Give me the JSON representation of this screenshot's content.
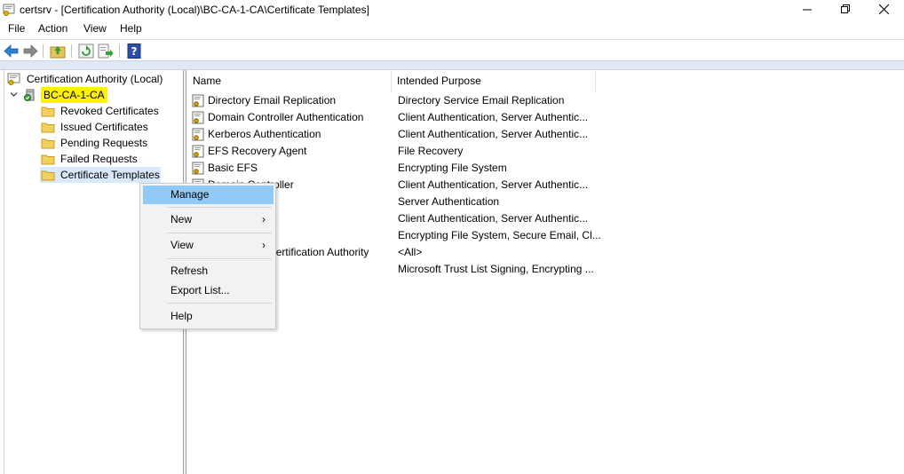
{
  "window": {
    "title": "certsrv - [Certification Authority (Local)\\BC-CA-1-CA\\Certificate Templates]",
    "minimize_icon": "minimize-icon",
    "maximize_icon": "restore-icon",
    "close_icon": "close-icon"
  },
  "menubar": {
    "items": [
      "File",
      "Action",
      "View",
      "Help"
    ]
  },
  "toolbar": {
    "icons": [
      "back-arrow-icon",
      "forward-arrow-icon",
      "up-folder-icon",
      "refresh-icon",
      "export-list-icon",
      "help-icon"
    ]
  },
  "tree": {
    "root": "Certification Authority (Local)",
    "ca": "BC-CA-1-CA",
    "children": [
      "Revoked Certificates",
      "Issued Certificates",
      "Pending Requests",
      "Failed Requests",
      "Certificate Templates"
    ]
  },
  "list": {
    "columns": [
      "Name",
      "Intended Purpose"
    ],
    "rows": [
      {
        "name": "Directory Email Replication",
        "purpose": "Directory Service Email Replication"
      },
      {
        "name": "Domain Controller Authentication",
        "purpose": "Client Authentication, Server Authentic..."
      },
      {
        "name": "Kerberos Authentication",
        "purpose": "Client Authentication, Server Authentic..."
      },
      {
        "name": "EFS Recovery Agent",
        "purpose": "File Recovery"
      },
      {
        "name": "Basic EFS",
        "purpose": "Encrypting File System"
      },
      {
        "name": "Domain Controller",
        "purpose": "Client Authentication, Server Authentic..."
      },
      {
        "name": "",
        "purpose": "Server Authentication"
      },
      {
        "name": "",
        "purpose": "Client Authentication, Server Authentic..."
      },
      {
        "name": "",
        "purpose": "Encrypting File System, Secure Email, Cl..."
      },
      {
        "name": "Subordinate Certification Authority",
        "purpose": "<All>"
      },
      {
        "name": "",
        "purpose": "Microsoft Trust List Signing, Encrypting ..."
      }
    ]
  },
  "context_menu": {
    "items": [
      {
        "label": "Manage",
        "submenu": false
      },
      {
        "label": "New",
        "submenu": true
      },
      {
        "label": "View",
        "submenu": true
      },
      {
        "label": "Refresh",
        "submenu": false
      },
      {
        "label": "Export List...",
        "submenu": false
      },
      {
        "label": "Help",
        "submenu": false
      }
    ],
    "submenu_arrow": "›"
  },
  "colors": {
    "highlight": "#fff200",
    "menu_active": "#91c9f7",
    "band": "#dfe9f5"
  }
}
